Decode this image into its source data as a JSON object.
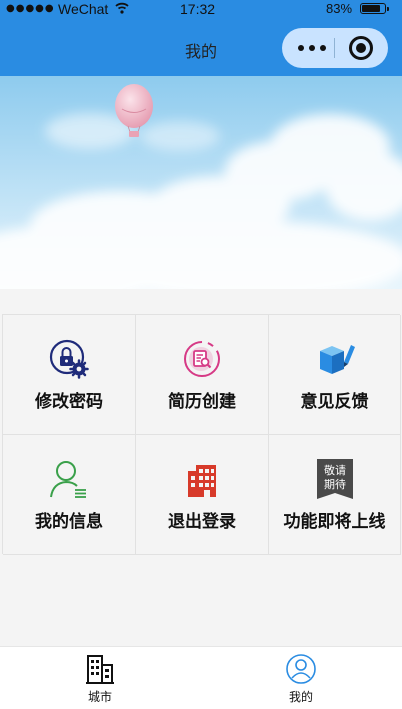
{
  "status_bar": {
    "signal": "●●●●●",
    "carrier": "WeChat",
    "time": "17:32",
    "battery": "83%"
  },
  "nav": {
    "title": "我的"
  },
  "grid": [
    {
      "label": "修改密码",
      "icon": "lock-gear-icon"
    },
    {
      "label": "简历创建",
      "icon": "resume-search-icon"
    },
    {
      "label": "意见反馈",
      "icon": "box-pencil-icon"
    },
    {
      "label": "我的信息",
      "icon": "user-list-icon"
    },
    {
      "label": "退出登录",
      "icon": "building-exit-icon"
    },
    {
      "label": "功能即将上线",
      "icon": "coming-soon-icon",
      "badge": [
        "敬请",
        "期待"
      ]
    }
  ],
  "tabbar": [
    {
      "label": "城市",
      "icon": "building-icon",
      "active": false
    },
    {
      "label": "我的",
      "icon": "profile-icon",
      "active": true
    }
  ],
  "colors": {
    "header": "#2a8ce2",
    "capsule": "#c9e3ff",
    "active_tab": "#2a8ce2",
    "lock_icon": "#1f2b7a",
    "resume_icon": "#d63a86",
    "feedback_icon": "#2a8ce2",
    "user_icon": "#3aa04a",
    "exit_icon": "#d73a2a",
    "badge_bg": "#4a4a4a"
  }
}
